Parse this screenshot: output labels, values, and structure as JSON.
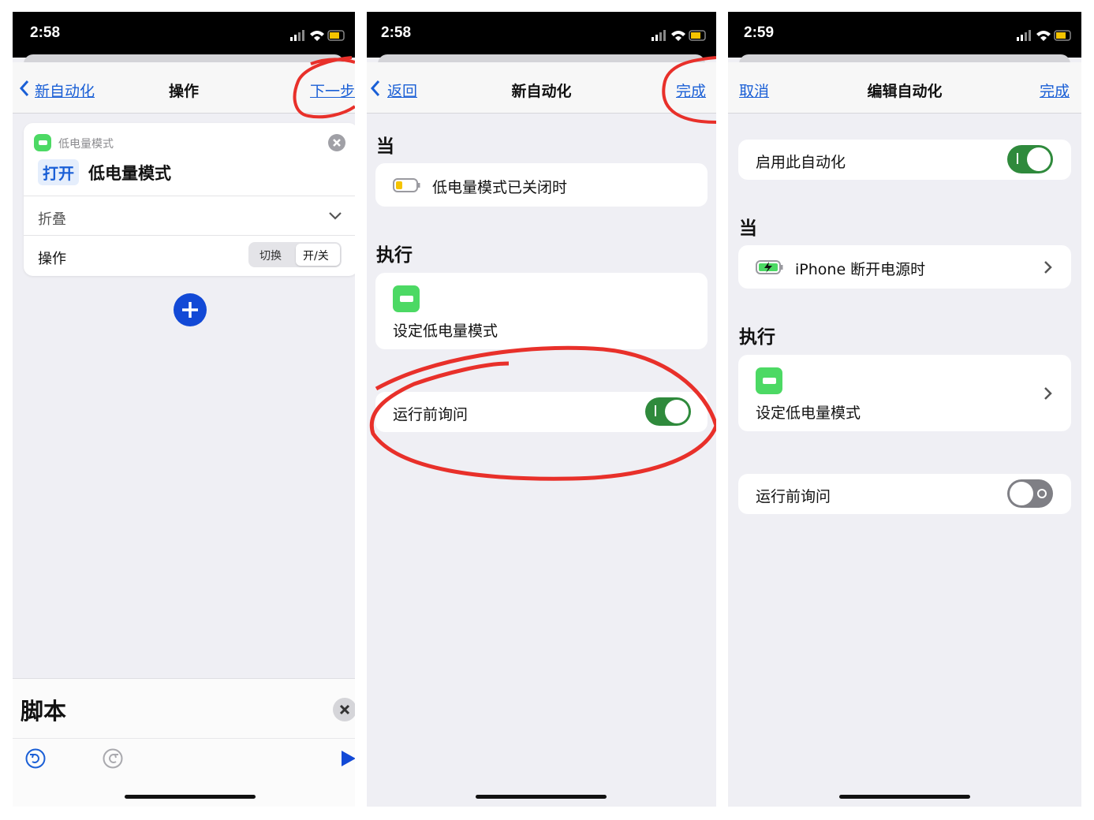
{
  "panel1": {
    "status": {
      "time": "2:58"
    },
    "nav": {
      "back": "新自动化",
      "title": "操作",
      "next": "下一步"
    },
    "action_card": {
      "app_label": "低电量模式",
      "verb": "打开",
      "target": "低电量模式",
      "collapse_label": "折叠",
      "operation_label": "操作",
      "segment_options": [
        "切换",
        "开/关"
      ],
      "segment_selected": "开/关"
    },
    "scripts_panel": {
      "title": "脚本"
    }
  },
  "panel2": {
    "status": {
      "time": "2:58"
    },
    "nav": {
      "back": "返回",
      "title": "新自动化",
      "done": "完成"
    },
    "when_header": "当",
    "trigger": "低电量模式已关闭时",
    "do_header": "执行",
    "action": "设定低电量模式",
    "ask_label": "运行前询问",
    "ask_enabled": true
  },
  "panel3": {
    "status": {
      "time": "2:59"
    },
    "nav": {
      "cancel": "取消",
      "title": "编辑自动化",
      "done": "完成"
    },
    "enable_label": "启用此自动化",
    "enable_on": true,
    "when_header": "当",
    "trigger": "iPhone 断开电源时",
    "do_header": "执行",
    "action": "设定低电量模式",
    "ask_label": "运行前询问",
    "ask_enabled": false
  },
  "colors": {
    "link": "#1a5fd6",
    "toggle_on": "#2f8a3c",
    "annotation": "#e8302a",
    "green": "#4cd964"
  }
}
